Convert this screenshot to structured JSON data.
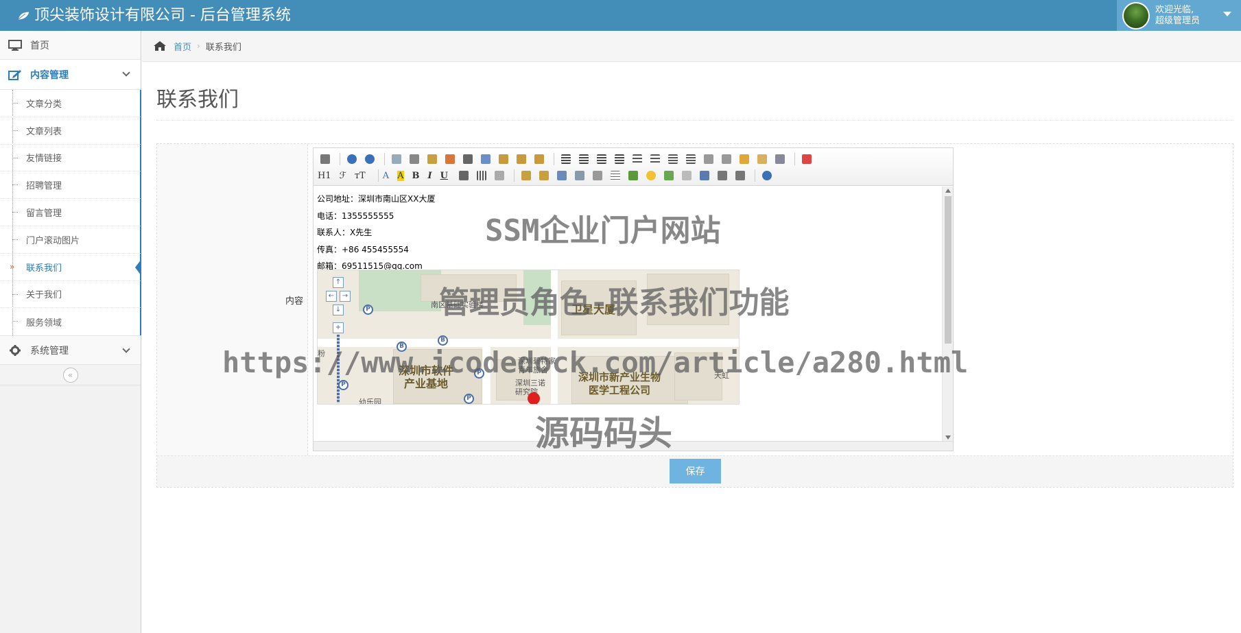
{
  "header": {
    "brand_title": "顶尖装饰设计有限公司 - 后台管理系统",
    "welcome_line1": "欢迎光临,",
    "welcome_line2": "超级管理员"
  },
  "sidebar": {
    "home": "首页",
    "content_mgmt": "内容管理",
    "items": [
      "文章分类",
      "文章列表",
      "友情链接",
      "招聘管理",
      "留言管理",
      "门户滚动图片",
      "联系我们",
      "关于我们",
      "服务领域"
    ],
    "system_mgmt": "系统管理",
    "collapse_icon": "«"
  },
  "breadcrumb": {
    "home": "首页",
    "separator": "›",
    "current": "联系我们"
  },
  "page": {
    "title": "联系我们",
    "field_label": "内容",
    "save_label": "保存"
  },
  "editor": {
    "toolbar_text": {
      "heading": "H1",
      "font_family": "ℱ",
      "font_size": "тT",
      "font_color": "A",
      "bg_color": "A",
      "bold": "B",
      "italic": "I",
      "underline": "U"
    },
    "lines": [
      "公司地址：深圳市南山区XX大厦",
      "电话：1355555555",
      "联系人：X先生",
      "传真：+86 455455554",
      "邮箱：69511515@qq.com"
    ],
    "map": {
      "big_labels": [
        "卫星大厦",
        "深圳市软件\n产业基地",
        "深圳市新产业生物\n医学工程公司"
      ],
      "small_labels": [
        "南区基础实验楼",
        "深圳碧特家\n青年旅舍",
        "深圳三诺\n研究院",
        "天虹",
        "粉",
        "幼乐园"
      ]
    }
  },
  "watermarks": [
    "SSM企业门户网站",
    "管理员角色-联系我们功能",
    "https://www.icodedock.com/article/a280.html",
    "源码码头"
  ],
  "colors": {
    "navbar": "#438eb9",
    "user_box": "#62a8d1",
    "active": "#2b7dbc",
    "save_button": "#6fb3e0"
  }
}
